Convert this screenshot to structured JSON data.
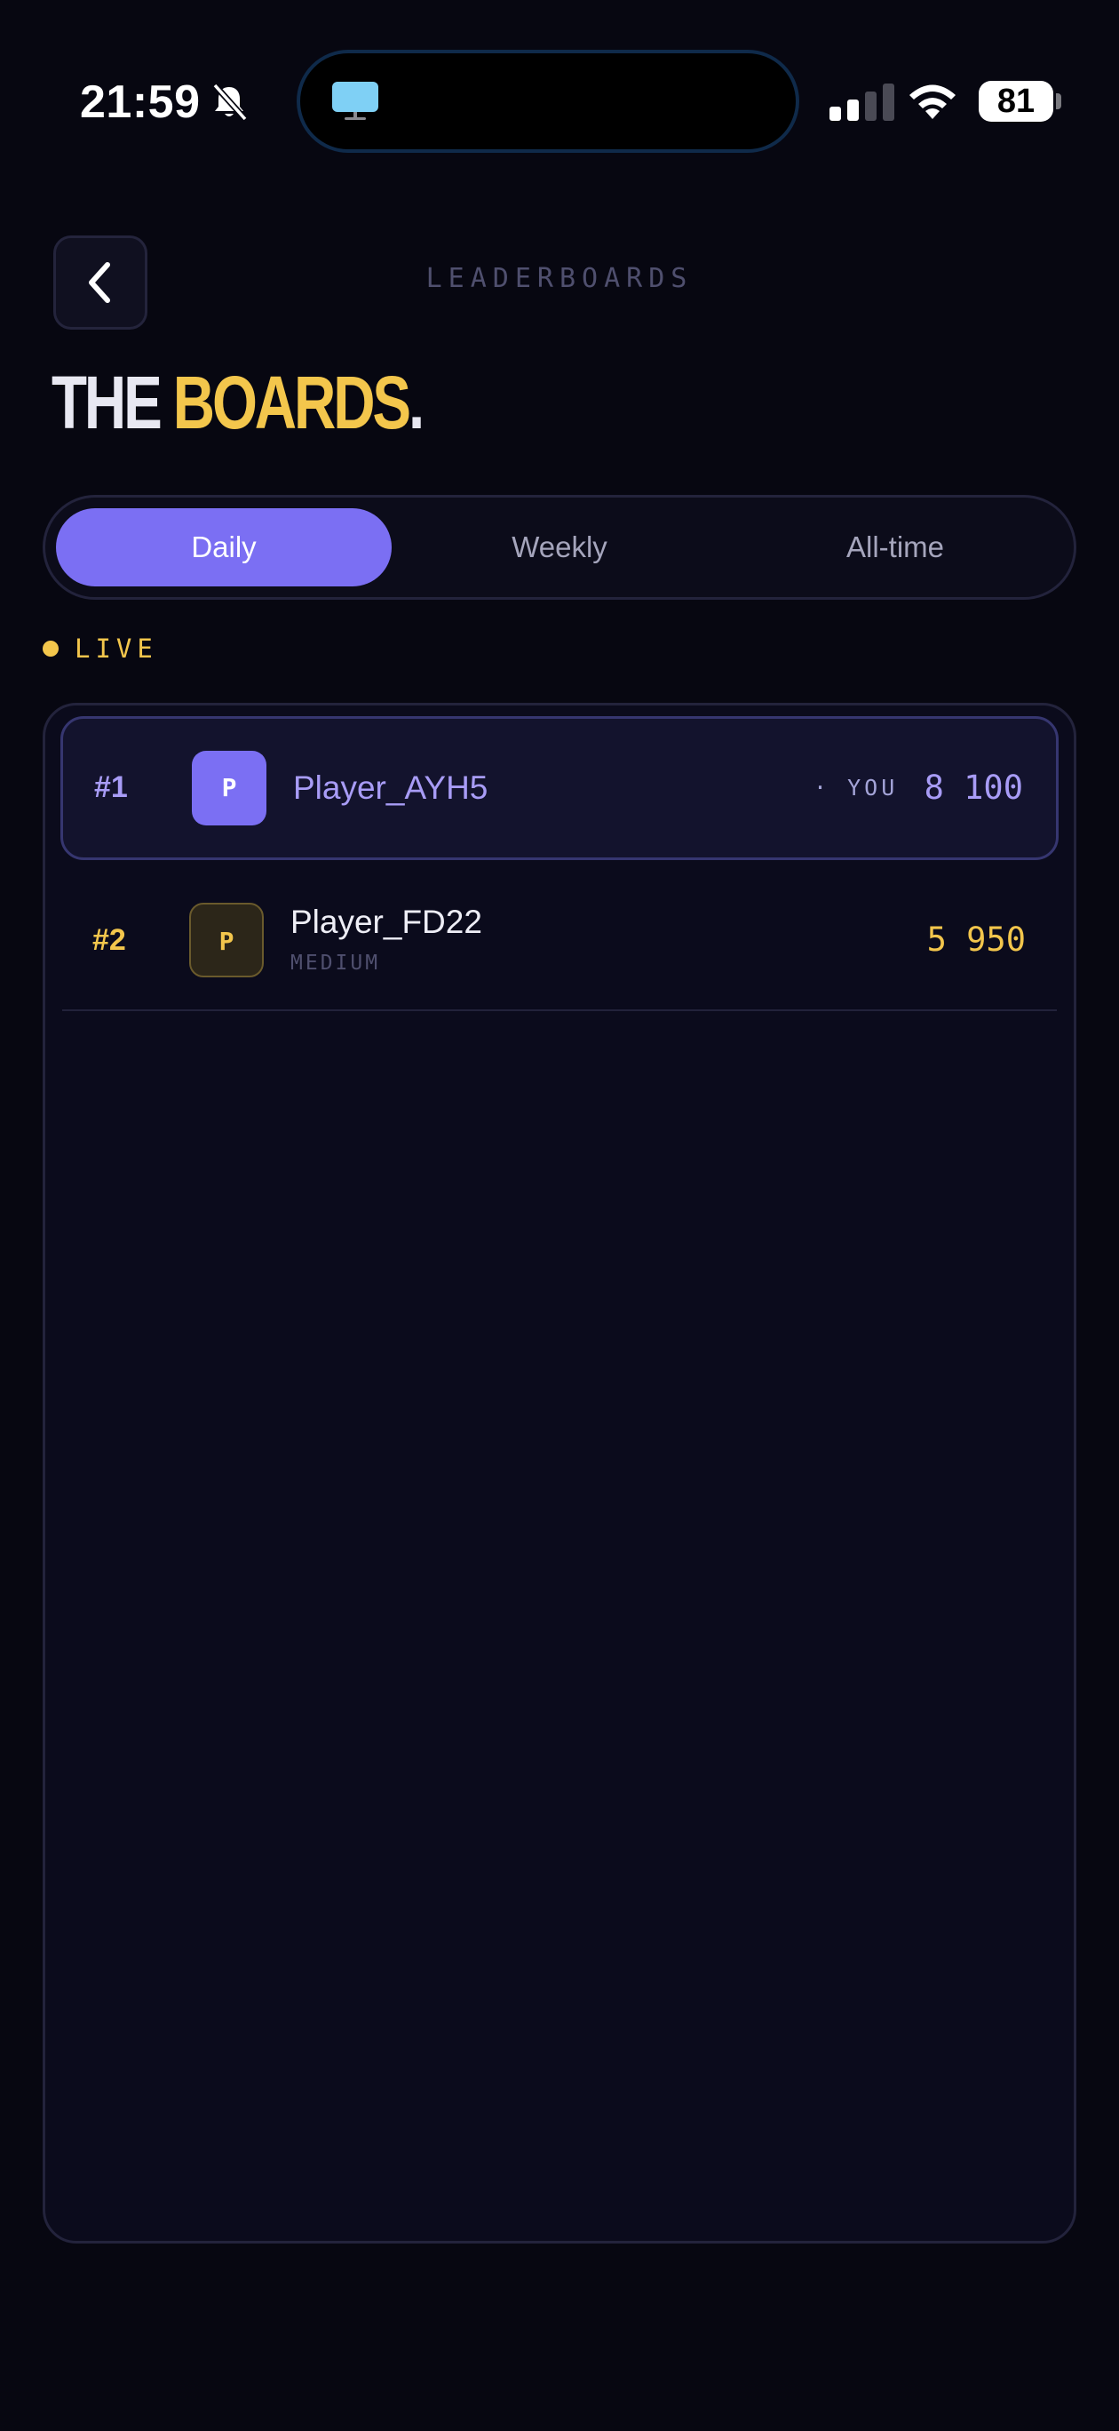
{
  "status_bar": {
    "time": "21:59",
    "battery": "81"
  },
  "header": {
    "label": "LEADERBOARDS",
    "title_part1": "THE ",
    "title_part2": "BOARDS",
    "title_part3": "."
  },
  "tabs": [
    {
      "label": "Daily",
      "active": true
    },
    {
      "label": "Weekly",
      "active": false
    },
    {
      "label": "All-time",
      "active": false
    }
  ],
  "live_label": "LIVE",
  "entries": [
    {
      "rank": "#1",
      "avatar": "P",
      "name": "Player_AYH5",
      "you_label": "· YOU",
      "score": "8 100",
      "is_you": true
    },
    {
      "rank": "#2",
      "avatar": "P",
      "name": "Player_FD22",
      "difficulty": "MEDIUM",
      "score": "5 950",
      "is_you": false
    }
  ],
  "colors": {
    "accent": "#7b6ff3",
    "gold": "#f3c64c",
    "background": "#070711"
  }
}
